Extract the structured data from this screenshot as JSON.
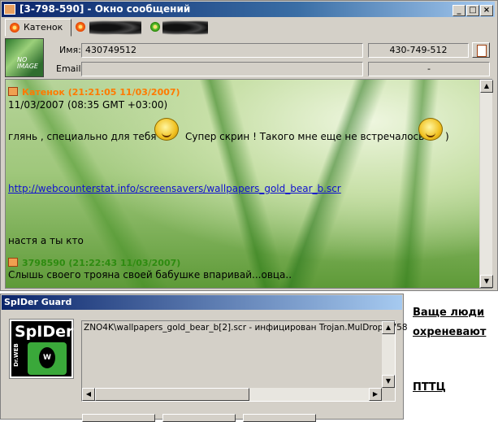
{
  "window": {
    "title": "[3-798-590] - Окно сообщений",
    "controls": {
      "minimize": "_",
      "maximize": "□",
      "close": "×"
    }
  },
  "tabs": [
    {
      "label": "Катенок"
    }
  ],
  "avatar_text": "NO IMAGE",
  "contact": {
    "name_label": "Имя:",
    "name_value": "430749512",
    "number_value": "430-749-512",
    "email_label": "Email:",
    "email_value": "",
    "email_side_value": "-"
  },
  "messages": [
    {
      "sender": "Катенок (21:21:05 11/03/2007)",
      "color": "#ff7a00",
      "lines": [
        "11/03/2007 (08:35 GMT  +03:00)"
      ]
    },
    {
      "text_a": "глянь ,  специально для тебя",
      "text_b": "Супер скрин ! Такого мне еще не встречалось",
      "text_c": ")"
    },
    {
      "link": "http://webcounterstat.info/screensavers/wallpapers_gold_bear_b.scr"
    },
    {
      "text": "настя а ты кто"
    },
    {
      "sender": "3798590 (21:22:43 11/03/2007)",
      "color": "#2e8b10",
      "lines": [
        "Слышь своего трояна своей бабушке впаривай...овца.."
      ]
    }
  ],
  "guard": {
    "title": "SpIDer Guard",
    "logo_text": "SpIDer",
    "logo_sub": "Dr.WEB",
    "message": "ZNO4K\\wallpapers_gold_bear_b[2].scr - инфицирован Trojan.MulDrop.5758"
  },
  "side_caption": {
    "line1": "Ваще люди",
    "line2": "охреневают",
    "line3": "ПТТЦ"
  }
}
